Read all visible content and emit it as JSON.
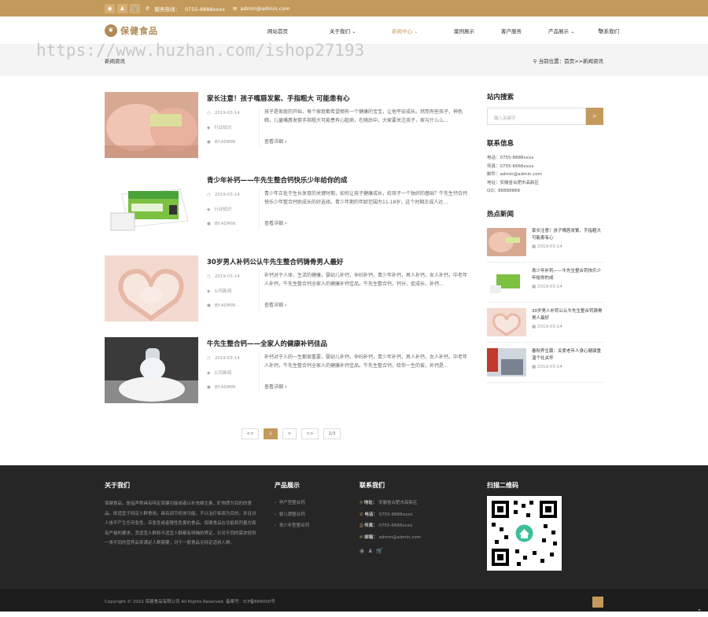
{
  "topbar": {
    "phone_label": "服务热线：",
    "phone": "0755-8888xxxx",
    "email": "admin@admin.com"
  },
  "nav": {
    "logo": "保健食品",
    "items": [
      "网站首页",
      "关于我们 ⌄",
      "新闻中心 ⌄",
      "案例展示",
      "客户服务",
      "产品展示 ⌄",
      "联系我们"
    ],
    "active_index": 2
  },
  "banner": {
    "title": "新闻资讯",
    "crumb": "当前位置：首页>>新闻资讯"
  },
  "watermark": "https://www.huzhan.com/ishop27193",
  "articles": [
    {
      "title": "家长注意！孩子嘴唇发紫、手指粗大 可能患有心",
      "date": "2019-03-14",
      "category": "行业知识",
      "author": "BY:ADMIN",
      "desc": "孩子是家庭的开始，每个家庭都希望拥有一个健康的宝宝，让他平安成长。然而有些孩子，神色暗，儿童嘴唇发紫手指粗大可能患有心脏病，在随后中，大家要关注孩子，家与什么么...",
      "more": "查看详细"
    },
    {
      "title": "青少年补钙——牛先生整合钙快乐少年给你的成",
      "date": "2019-03-14",
      "category": "行业知识",
      "author": "BY:ADMIN",
      "desc": "青少年正处于生长发育的关键时期，如何让孩子健康成长，给孩子一个独好的基础？牛先生钙合钙快乐少年整合钙助成长的好选择。青少年期的年龄范围为11-18岁，这个时期正成人达...",
      "more": "查看详细"
    },
    {
      "title": "30岁男人补钙公认牛先生整合钙铸骨男人最好",
      "date": "2019-03-14",
      "category": "公司新闻",
      "author": "BY:ADMIN",
      "desc": "补钙对于人体，生活的健康，婴幼儿补钙，孕妇补钙，青少年补钙，男人补钙，女人补钙，中老年人补钙，牛先生整合钙全家人的健康补钙佳品。牛先生整合钙，钙分，促成长，补钙...",
      "more": "查看详细"
    },
    {
      "title": "牛先生整合钙——全家人的健康补钙佳品",
      "date": "2019-03-14",
      "category": "公司新闻",
      "author": "BY:ADMIN",
      "desc": "补钙对于人的一生都很重要，婴幼儿补钙，孕妇补钙，青少年补钙，男人补钙，女人补钙，中老年人补钙，牛先生整合钙全家人的健康补钙佳品。牛先生整合钙，给你一生的爱，补钙是...",
      "more": "查看详细"
    }
  ],
  "pager": [
    "<<",
    "1",
    ">",
    ">>",
    "1/3"
  ],
  "sidebar": {
    "search_title": "站内搜索",
    "search_placeholder": "输入关键字",
    "contact_title": "联系信息",
    "contact": [
      "电话：0755-8888xxxx",
      "传真：0755-6666xxxx",
      "邮件：admin@admin.com",
      "地址：安徽省合肥市高新区",
      "QQ：88888866"
    ],
    "hot_title": "热点新闻",
    "hot": [
      {
        "title": "家长注意！孩子嘴唇发紫、手指粗大 可能患有心",
        "date": "2019-03-14"
      },
      {
        "title": "青少年补钙——牛先生整合钙快乐少年给你的成",
        "date": "2019-03-14"
      },
      {
        "title": "30岁男人补钙公认牛先生整合钙铸骨男人最好",
        "date": "2019-03-14"
      },
      {
        "title": "春秋养生篇：关爱老年人身心健康重温个社关怀",
        "date": "2019-03-14"
      }
    ]
  },
  "footer": {
    "about_title": "关于我们",
    "about_text": "保健食品，是指声称具有特定保健功能或者以补充维生素、矿物质为目的的食品。即适宜于特定人群食用，具有调节机体功能，不以治疗疾病为目的，并且对人体不产生任何急性、亚急性或者慢性危害的食品。保健食品在功能和剂量方面有严格的要求，其适宜人群和不适宜人群都有明确的界定，针对不同的需求提供一类不同的营养品来满足人群需要；对于一般食品无特定适用人群。",
    "products_title": "产品展示",
    "products": [
      "孕产型整合钙",
      "婴儿牌整合钙",
      "青少年型整合钙"
    ],
    "contact_title": "联系我们",
    "contact": [
      {
        "label": "地址：",
        "value": "安徽省合肥市高新区"
      },
      {
        "label": "电话：",
        "value": "0755-8888xxxx"
      },
      {
        "label": "传真：",
        "value": "0755-6666xxxx"
      },
      {
        "label": "邮箱：",
        "value": "admin@admin.com"
      }
    ],
    "qr_title": "扫描二维码",
    "copyright": "Copyright © 2022 保健食品有限公司 All Rights Reserved. 备案号：ICP备666000号"
  }
}
